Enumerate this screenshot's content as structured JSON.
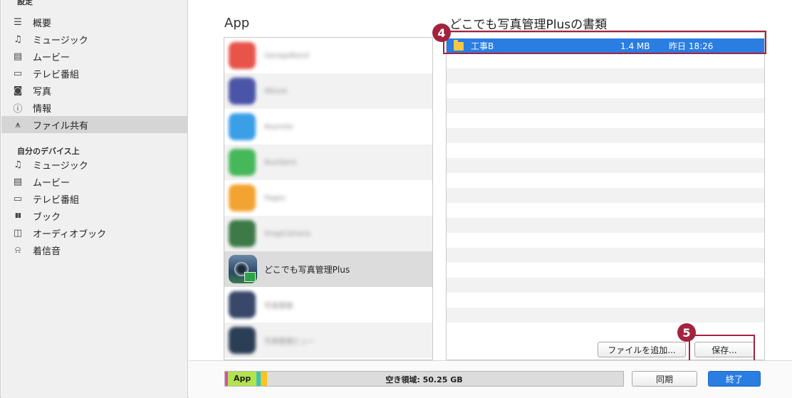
{
  "sidebar": {
    "cut_header": "設定",
    "settings_items": [
      {
        "label": "概要",
        "icon": "summary-icon",
        "glyph": "☰"
      },
      {
        "label": "ミュージック",
        "icon": "music-icon",
        "glyph": "♫"
      },
      {
        "label": "ムービー",
        "icon": "movie-icon",
        "glyph": "▤"
      },
      {
        "label": "テレビ番組",
        "icon": "tv-icon",
        "glyph": "▭"
      },
      {
        "label": "写真",
        "icon": "camera-icon",
        "glyph": "◙"
      },
      {
        "label": "情報",
        "icon": "info-icon",
        "glyph": "ⓘ"
      },
      {
        "label": "ファイル共有",
        "icon": "file-sharing-icon",
        "glyph": "⩚"
      }
    ],
    "device_header": "自分のデバイス上",
    "device_items": [
      {
        "label": "ミュージック",
        "icon": "music-icon",
        "glyph": "♫"
      },
      {
        "label": "ムービー",
        "icon": "movie-icon",
        "glyph": "▤"
      },
      {
        "label": "テレビ番組",
        "icon": "tv-icon",
        "glyph": "▭"
      },
      {
        "label": "ブック",
        "icon": "book-icon",
        "glyph": "▮▮"
      },
      {
        "label": "オーディオブック",
        "icon": "audiobook-icon",
        "glyph": "◫"
      },
      {
        "label": "着信音",
        "icon": "bell-icon",
        "glyph": "⍾"
      }
    ]
  },
  "apps": {
    "title": "App",
    "rows": [
      {
        "icon_color": "#e8544a"
      },
      {
        "icon_color": "#4b55a8"
      },
      {
        "icon_color": "#3a9fe6"
      },
      {
        "icon_color": "#45b85a"
      },
      {
        "icon_color": "#f2a432"
      },
      {
        "icon_color": "#3d7a48"
      },
      {
        "label": "どこでも写真管理Plus",
        "selected": true
      },
      {
        "icon_color": "#39476a"
      },
      {
        "icon_color": "#2c3e55"
      }
    ]
  },
  "documents": {
    "title": "どこでも写真管理Plusの書類",
    "selected": {
      "name": "工事B",
      "size": "1.4 MB",
      "date": "昨日 18:26"
    },
    "add_button": "ファイルを追加...",
    "save_button": "保存..."
  },
  "callouts": {
    "step4": "4",
    "step5": "5"
  },
  "storage": {
    "app_label": "App",
    "free_label": "空き領域: 50.25 GB"
  },
  "footer": {
    "sync_button": "同期",
    "done_button": "終了"
  },
  "colors": {
    "accent": "#2a7de1",
    "callout": "#a3233f",
    "storage_app": "#b3e34e",
    "storage_pink": "#e24aa8",
    "storage_teal": "#3cc3b8",
    "storage_yellow": "#f7c325"
  }
}
